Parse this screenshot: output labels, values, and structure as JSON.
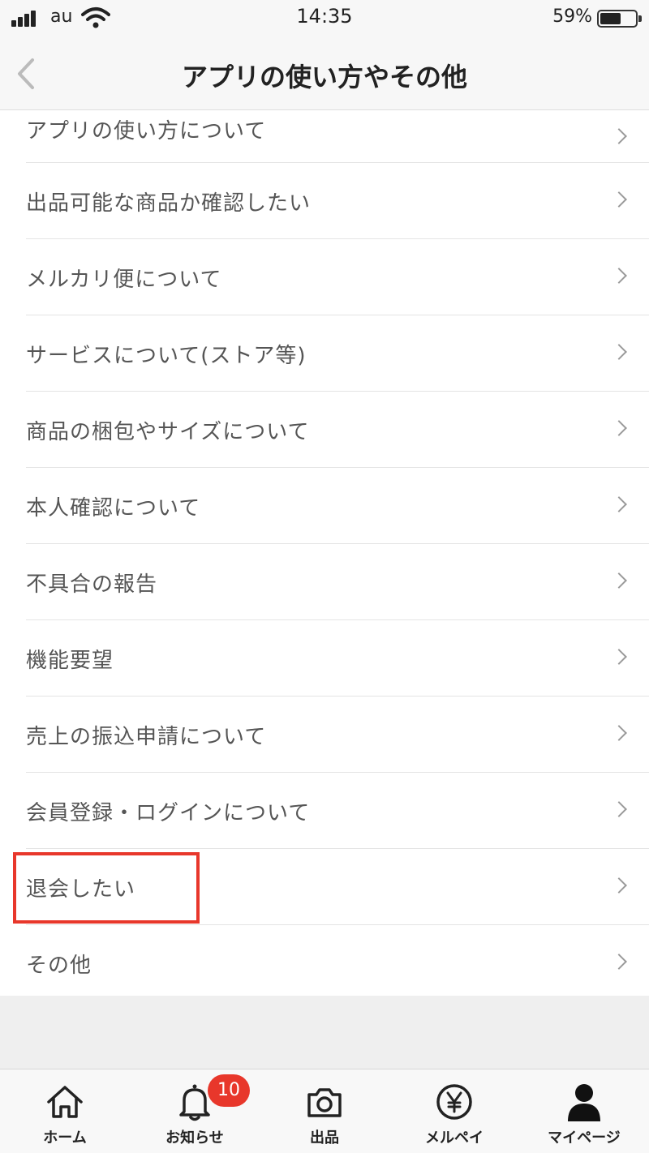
{
  "status_bar": {
    "carrier": "au",
    "time": "14:35",
    "battery_percent": "59%",
    "battery_level": 0.59
  },
  "header": {
    "title": "アプリの使い方やその他",
    "back_icon": "chevron-left-icon"
  },
  "menu_items": [
    {
      "label": "アプリの使い方について"
    },
    {
      "label": "出品可能な商品か確認したい"
    },
    {
      "label": "メルカリ便について"
    },
    {
      "label": "サービスについて(ストア等)"
    },
    {
      "label": "商品の梱包やサイズについて"
    },
    {
      "label": "本人確認について"
    },
    {
      "label": "不具合の報告"
    },
    {
      "label": "機能要望"
    },
    {
      "label": "売上の振込申請について"
    },
    {
      "label": "会員登録・ログインについて"
    },
    {
      "label": "退会したい",
      "highlighted": true
    },
    {
      "label": "その他"
    }
  ],
  "highlight_color": "#e8372b",
  "tab_bar": {
    "tabs": [
      {
        "label": "ホーム",
        "icon": "home-icon"
      },
      {
        "label": "お知らせ",
        "icon": "bell-icon",
        "badge": "10"
      },
      {
        "label": "出品",
        "icon": "camera-icon"
      },
      {
        "label": "メルペイ",
        "icon": "yen-icon"
      },
      {
        "label": "マイページ",
        "icon": "person-icon"
      }
    ]
  }
}
